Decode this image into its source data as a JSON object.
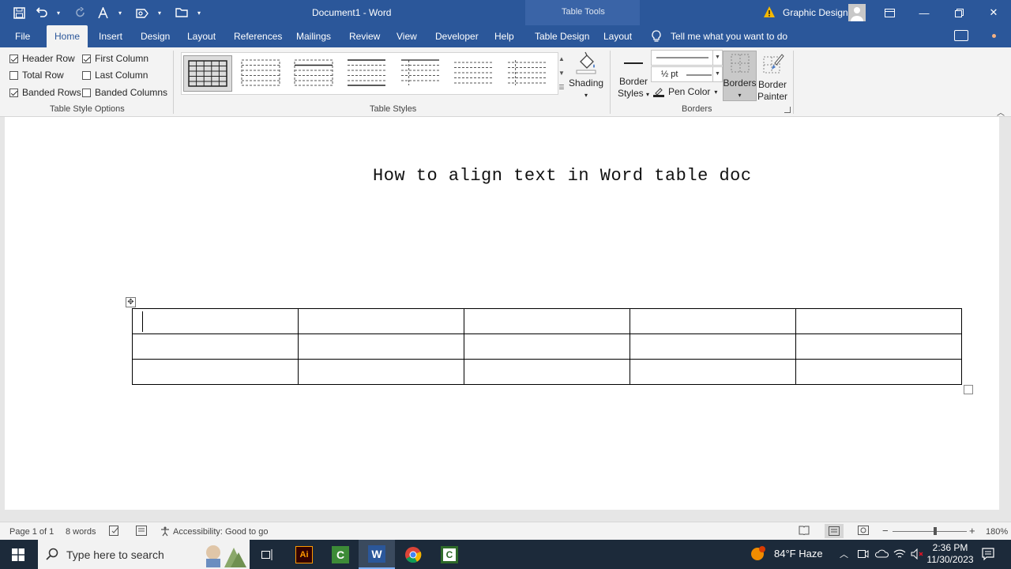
{
  "titlebar": {
    "doc_title": "Document1  -  Word",
    "context_label": "Table Tools",
    "user_name": "Graphic Design"
  },
  "tabs": [
    {
      "label": "File"
    },
    {
      "label": "Home"
    },
    {
      "label": "Insert"
    },
    {
      "label": "Design"
    },
    {
      "label": "Layout"
    },
    {
      "label": "References"
    },
    {
      "label": "Mailings"
    },
    {
      "label": "Review"
    },
    {
      "label": "View"
    },
    {
      "label": "Developer"
    },
    {
      "label": "Help"
    },
    {
      "label": "Table Design"
    },
    {
      "label": "Layout"
    }
  ],
  "tell_me": "Tell me what you want to do",
  "table_style_options": {
    "group_label": "Table Style Options",
    "options": [
      {
        "label": "Header Row",
        "checked": true
      },
      {
        "label": "First Column",
        "checked": true
      },
      {
        "label": "Total Row",
        "checked": false
      },
      {
        "label": "Last Column",
        "checked": false
      },
      {
        "label": "Banded Rows",
        "checked": true
      },
      {
        "label": "Banded Columns",
        "checked": false
      }
    ]
  },
  "table_styles": {
    "group_label": "Table Styles",
    "shading_label": "Shading"
  },
  "borders": {
    "group_label": "Borders",
    "border_styles_line1": "Border",
    "border_styles_line2": "Styles",
    "pen_weight": "½ pt",
    "pen_color_label": "Pen Color",
    "borders_label": "Borders",
    "painter_line1": "Border",
    "painter_line2": "Painter"
  },
  "document": {
    "heading": "How to align text in Word table doc",
    "table": {
      "rows": 3,
      "cols": 5
    }
  },
  "statusbar": {
    "page": "Page 1 of 1",
    "words": "8 words",
    "accessibility": "Accessibility: Good to go",
    "zoom": "180%"
  },
  "taskbar": {
    "search_placeholder": "Type here to search",
    "weather": "84°F  Haze",
    "time": "2:36 PM",
    "date": "11/30/2023"
  }
}
